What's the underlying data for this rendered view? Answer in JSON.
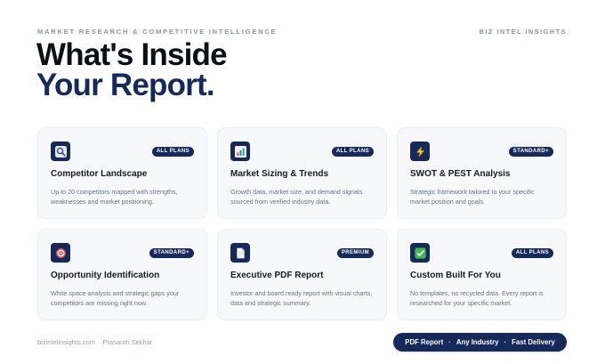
{
  "header": {
    "eyebrow": "MARKET RESEARCH & COMPETITIVE INTELLIGENCE",
    "brand": "BIZ INTEL INSIGHTS",
    "title_line1": "What's Inside",
    "title_line2": "Your Report."
  },
  "cards": [
    {
      "icon": "magnifier-icon",
      "badge": "ALL PLANS",
      "title": "Competitor Landscape",
      "desc": "Up to 20 competitors mapped with strengths, weaknesses and market positioning."
    },
    {
      "icon": "bar-chart-icon",
      "badge": "ALL PLANS",
      "title": "Market Sizing & Trends",
      "desc": "Growth data, market size, and demand signals sourced from verified industry data."
    },
    {
      "icon": "lightning-icon",
      "badge": "STANDARD+",
      "title": "SWOT & PEST Analysis",
      "desc": "Strategic framework tailored to your specific market position and goals."
    },
    {
      "icon": "target-icon",
      "badge": "STANDARD+",
      "title": "Opportunity Identification",
      "desc": "White space analysis and strategic gaps your competitors are missing right now."
    },
    {
      "icon": "document-icon",
      "badge": "PREMIUM",
      "title": "Executive PDF Report",
      "desc": "Investor and board ready report with visual charts, data and strategic summary."
    },
    {
      "icon": "checkmark-icon",
      "badge": "ALL PLANS",
      "title": "Custom Built For You",
      "desc": "No templates, no recycled data. Every report is researched for your specific market."
    }
  ],
  "footer": {
    "site": "bizintelinsights.com",
    "separator": "·",
    "author": "Prasanth Sekhar",
    "pill_items": [
      "PDF Report",
      "Any Industry",
      "Fast Delivery"
    ],
    "pill_separator": "·"
  },
  "colors": {
    "navy": "#15295a",
    "card_bg": "#f7f8fa"
  }
}
